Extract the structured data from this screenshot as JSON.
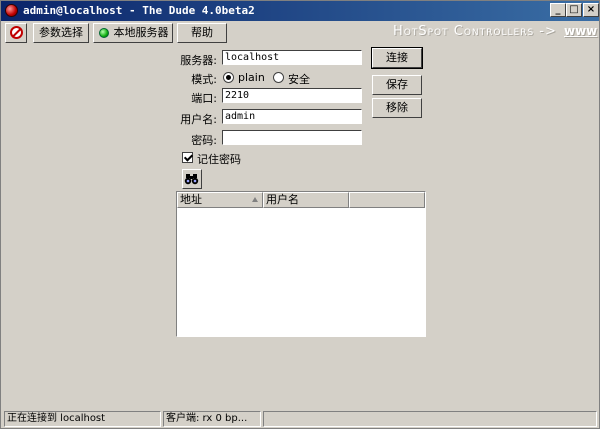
{
  "window": {
    "title": "admin@localhost - The Dude 4.0beta2",
    "controls": {
      "minimize": "_",
      "maximize": "□",
      "close": "×"
    }
  },
  "toolbar": {
    "prefs_label": "参数选择",
    "local_server_label": "本地服务器",
    "help_label": "帮助",
    "brand": "HotSpot Controllers ->",
    "brand_www": "www"
  },
  "form": {
    "server_label": "服务器:",
    "server_value": "localhost",
    "mode_label": "模式:",
    "mode_options": [
      "plain",
      "安全"
    ],
    "mode_selected": "plain",
    "port_label": "端口:",
    "port_value": "2210",
    "username_label": "用户名:",
    "username_value": "admin",
    "password_label": "密码:",
    "password_value": "",
    "remember_label": "记住密码",
    "remember_checked": true
  },
  "buttons": {
    "connect": "连接",
    "save": "保存",
    "remove": "移除"
  },
  "server_list": {
    "columns": [
      "地址",
      "用户名"
    ],
    "rows": []
  },
  "statusbar": {
    "connection": "正在连接到 localhost",
    "client": "客户端: rx 0 bp..."
  },
  "icons": {
    "app": "dude-red-ball-icon",
    "stop": "disconnect-icon",
    "local_server": "green-status-icon",
    "find": "binoculars-icon"
  }
}
